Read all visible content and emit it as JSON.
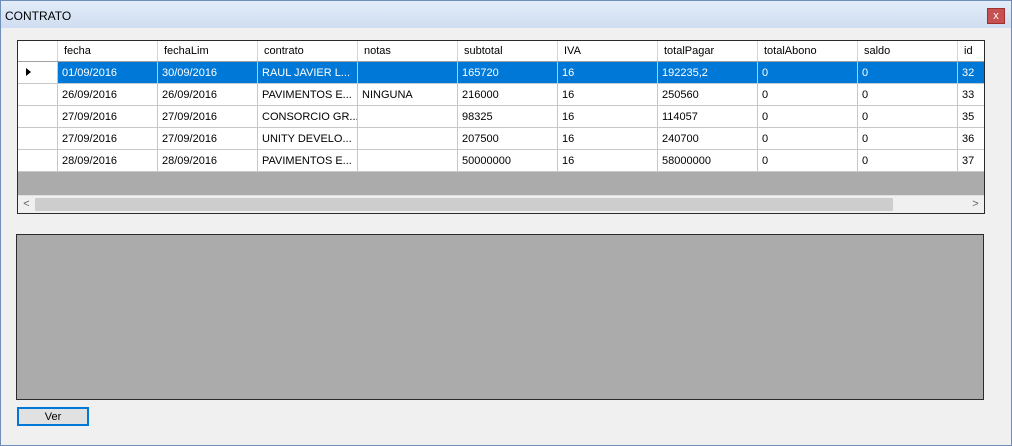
{
  "window": {
    "title": "CONTRATO",
    "close_label": "x"
  },
  "grid": {
    "columns": [
      "fecha",
      "fechaLim",
      "contrato",
      "notas",
      "subtotal",
      "IVA",
      "totalPagar",
      "totalAbono",
      "saldo",
      "id"
    ],
    "rows": [
      [
        "01/09/2016",
        "30/09/2016",
        "RAUL JAVIER L...",
        "",
        "165720",
        "16",
        "192235,2",
        "0",
        "0",
        "32"
      ],
      [
        "26/09/2016",
        "26/09/2016",
        "PAVIMENTOS E...",
        "NINGUNA",
        "216000",
        "16",
        "250560",
        "0",
        "0",
        "33"
      ],
      [
        "27/09/2016",
        "27/09/2016",
        "CONSORCIO GR...",
        "",
        "98325",
        "16",
        "114057",
        "0",
        "0",
        "35"
      ],
      [
        "27/09/2016",
        "27/09/2016",
        "UNITY DEVELO...",
        "",
        "207500",
        "16",
        "240700",
        "0",
        "0",
        "36"
      ],
      [
        "28/09/2016",
        "28/09/2016",
        "PAVIMENTOS E...",
        "",
        "50000000",
        "16",
        "58000000",
        "0",
        "0",
        "37"
      ]
    ],
    "selected_row": 0
  },
  "scrollbar": {
    "left_glyph": "<",
    "right_glyph": ">"
  },
  "buttons": {
    "ver_label": "Ver"
  },
  "colors": {
    "selection": "#0078d7",
    "empty_area": "#ababab",
    "title_bar": "#dce7f5"
  }
}
